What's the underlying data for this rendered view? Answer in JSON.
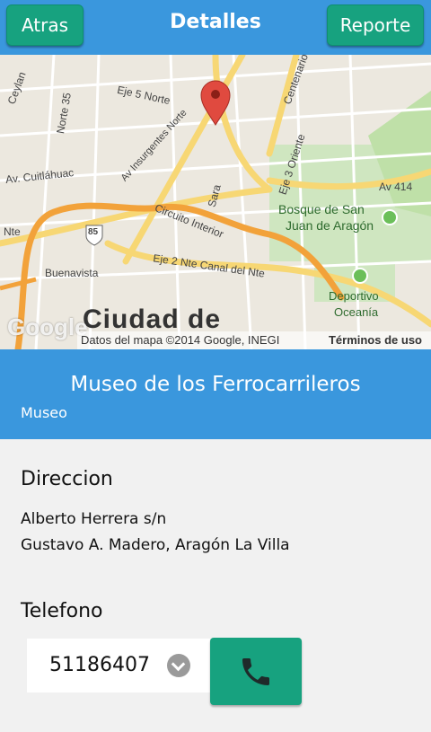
{
  "header": {
    "back_label": "Atras",
    "title": "Detalles",
    "report_label": "Reporte"
  },
  "map": {
    "labels": {
      "eje5": "Eje 5 Norte",
      "insurgentes": "Av Insurgentes Norte",
      "cuitlahuac": "Av. Cuitláhuac",
      "circuito": "Circuito Interior",
      "eje2": "Eje 2 Nte Canal del Nte",
      "eje3": "Eje 3 Oriente",
      "bosque1": "Bosque de San",
      "bosque2": "Juan de Aragón",
      "av414": "Av 414",
      "deportivo1": "Deportivo",
      "deportivo2": "Oceanía",
      "buenavista": "Buenavista",
      "norte35": "Norte 35",
      "ceylan": "Ceylan",
      "nte": "Nte",
      "centenario": "Centenario",
      "sara": "Sara",
      "route85": "85",
      "city": "Ciudad de",
      "google": "Google"
    },
    "attribution": "Datos del mapa ©2014 Google, INEGI",
    "terms": "Términos de uso"
  },
  "place": {
    "name": "Museo de los Ferrocarrileros",
    "type": "Museo"
  },
  "details": {
    "address_title": "Direccion",
    "address_line1": "Alberto Herrera s/n",
    "address_line2": "Gustavo A. Madero, Aragón La Villa",
    "phone_title": "Telefono",
    "phone": "51186407"
  }
}
